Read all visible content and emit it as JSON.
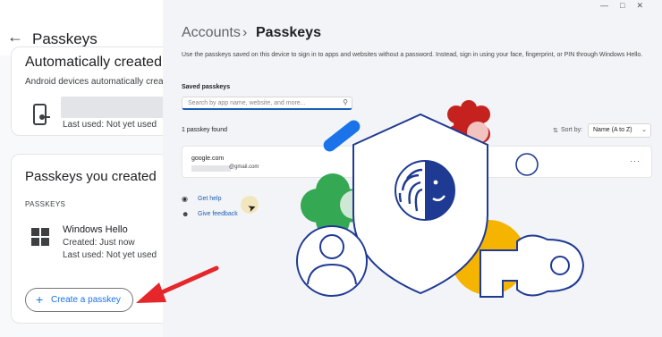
{
  "android": {
    "title": "Passkeys",
    "auto_card": {
      "title": "Automatically created p",
      "subtitle": "Android devices automatically creat",
      "last_used": "Last used: Not yet used"
    },
    "created_card": {
      "title": "Passkeys you created",
      "section_label": "PASSKEYS",
      "device_name": "Windows Hello",
      "created": "Created: Just now",
      "last_used": "Last used: Not yet used",
      "create_button": "Create a passkey"
    }
  },
  "windows": {
    "breadcrumb_parent": "Accounts",
    "breadcrumb_separator": "›",
    "breadcrumb_current": "Passkeys",
    "description": "Use the passkeys saved on this device to sign in to apps and websites without a password. Instead, sign in using your face, fingerprint, or PIN through Windows Hello.",
    "saved_label": "Saved passkeys",
    "search_placeholder": "Search by app name, website, and more...",
    "found_count": "1 passkey found",
    "sort_label": "Sort by:",
    "sort_value": "Name (A to Z)",
    "entry": {
      "site": "google.com",
      "email_suffix": "@gmail.com"
    },
    "get_help": "Get help",
    "give_feedback": "Give feedback"
  },
  "colors": {
    "accent_blue": "#1a73e8",
    "windows_link": "#1a5fb4",
    "arrow_red": "#e5262a",
    "illustration_navy": "#1f3a93",
    "illus_green": "#34a853",
    "illus_yellow": "#f5b400",
    "illus_red": "#c5221f"
  },
  "icons": [
    "back-arrow-icon",
    "phone-key-icon",
    "windows-logo-icon",
    "plus-icon",
    "search-icon",
    "sort-icon",
    "chevron-down-icon",
    "more-options-icon",
    "help-icon",
    "feedback-icon",
    "mouse-cursor-icon",
    "fingerprint-shield-icon",
    "user-circle-icon",
    "key-icon"
  ]
}
